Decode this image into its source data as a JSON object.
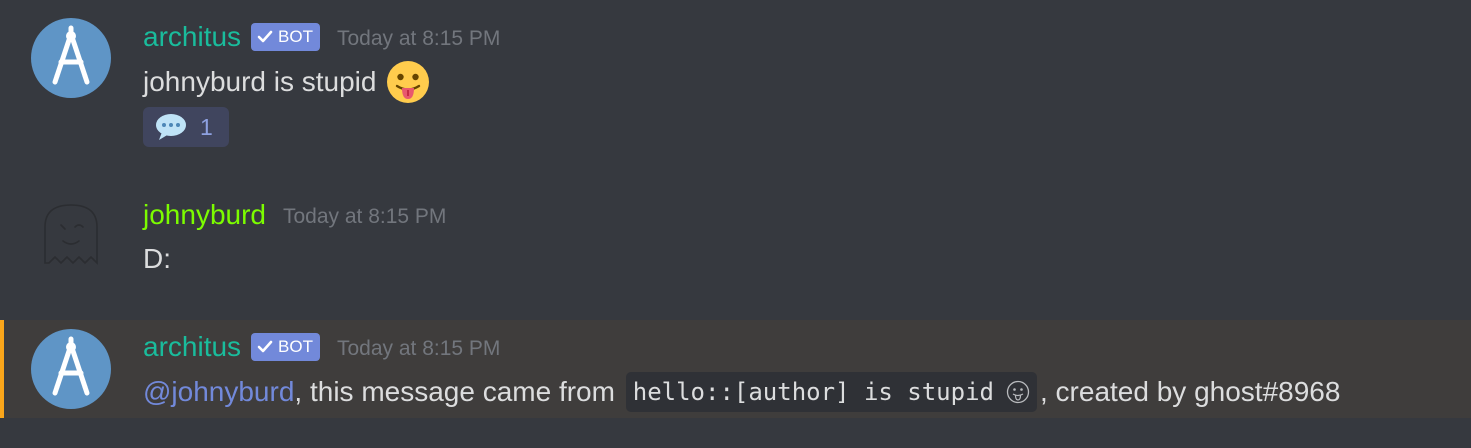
{
  "colors": {
    "background": "#36393f",
    "bot_username": "#1abc9c",
    "user_username": "#7cfc00",
    "bot_tag": "#7289da",
    "mention_bar": "#faa61a",
    "mention_bg": "#3f3d3c"
  },
  "messages": [
    {
      "author": "architus",
      "is_bot": true,
      "tag": "BOT",
      "timestamp": "Today at 8:15 PM",
      "avatar_icon": "compass-icon",
      "text": "johnyburd is stupid",
      "emoji": "stuck-out-tongue-emoji",
      "reaction": {
        "icon": "speech-balloon-icon",
        "count": "1"
      }
    },
    {
      "author": "johnyburd",
      "is_bot": false,
      "timestamp": "Today at 8:15 PM",
      "avatar_icon": "ghost-icon",
      "text": "D:"
    },
    {
      "author": "architus",
      "is_bot": true,
      "tag": "BOT",
      "timestamp": "Today at 8:15 PM",
      "avatar_icon": "compass-icon",
      "mention": "@johnyburd",
      "text_before_code": ", this message came from ",
      "code": "hello::[author] is stupid",
      "code_emoji": "stuck-out-tongue-emoji",
      "text_after_code": ", created by ghost#8968"
    }
  ]
}
